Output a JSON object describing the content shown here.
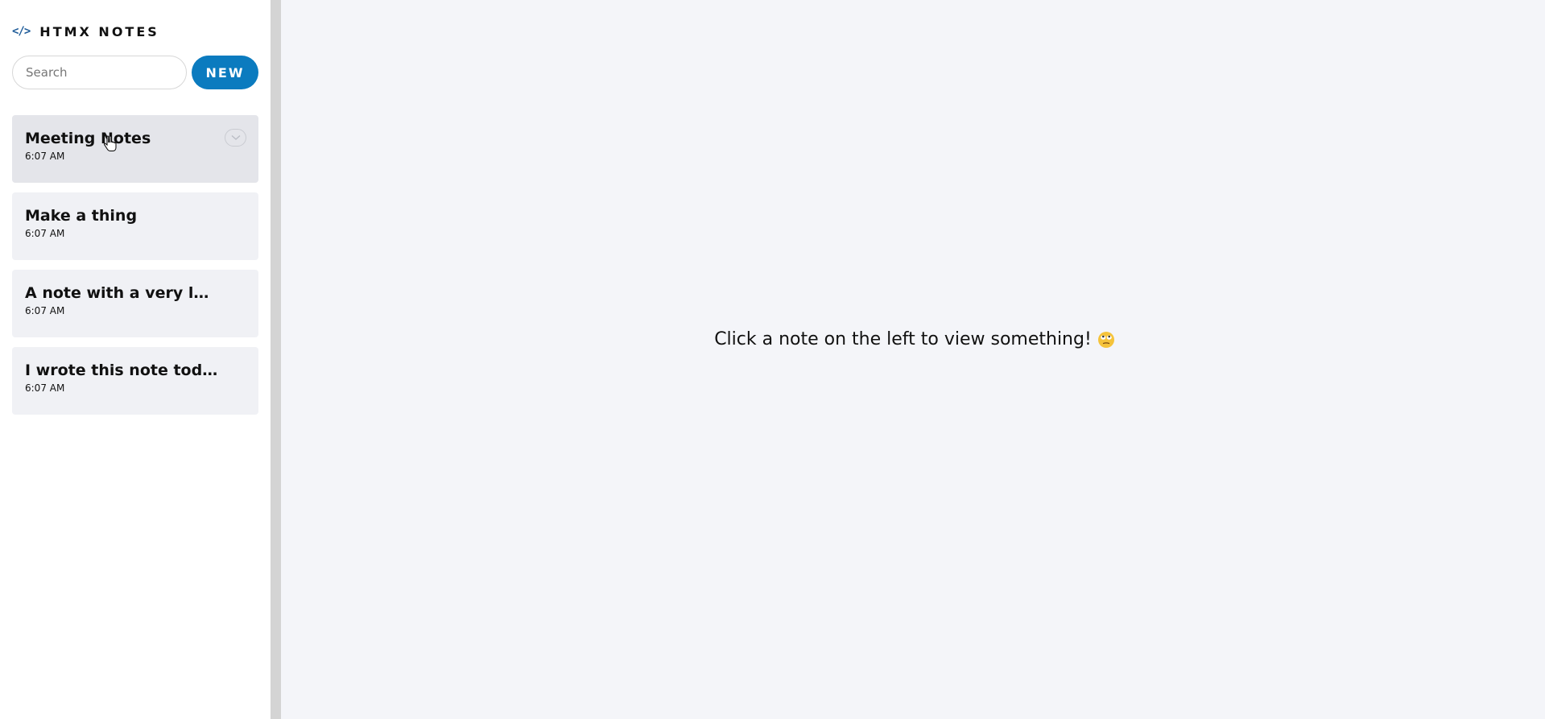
{
  "sidebar": {
    "brand_icon": "</>",
    "brand_title": "HTMX NOTES",
    "search_placeholder": "Search",
    "new_button_label": "NEW",
    "notes": [
      {
        "title": "Meeting Notes",
        "time": "6:07 AM",
        "active": true
      },
      {
        "title": "Make a thing",
        "time": "6:07 AM",
        "active": false
      },
      {
        "title": "A note with a very lon...",
        "time": "6:07 AM",
        "active": false
      },
      {
        "title": "I wrote this note today",
        "time": "6:07 AM",
        "active": false
      }
    ]
  },
  "main": {
    "placeholder_text": "Click a note on the left to view something!",
    "placeholder_emoji": "face-with-rolling-eyes-icon"
  },
  "colors": {
    "accent": "#0b7bbf",
    "brand_icon": "#1f5c99",
    "note_card_bg": "#f0f1f5",
    "note_card_active_bg": "#e4e5ea",
    "main_bg": "#f4f5f9",
    "divider": "#d4d4d4"
  }
}
